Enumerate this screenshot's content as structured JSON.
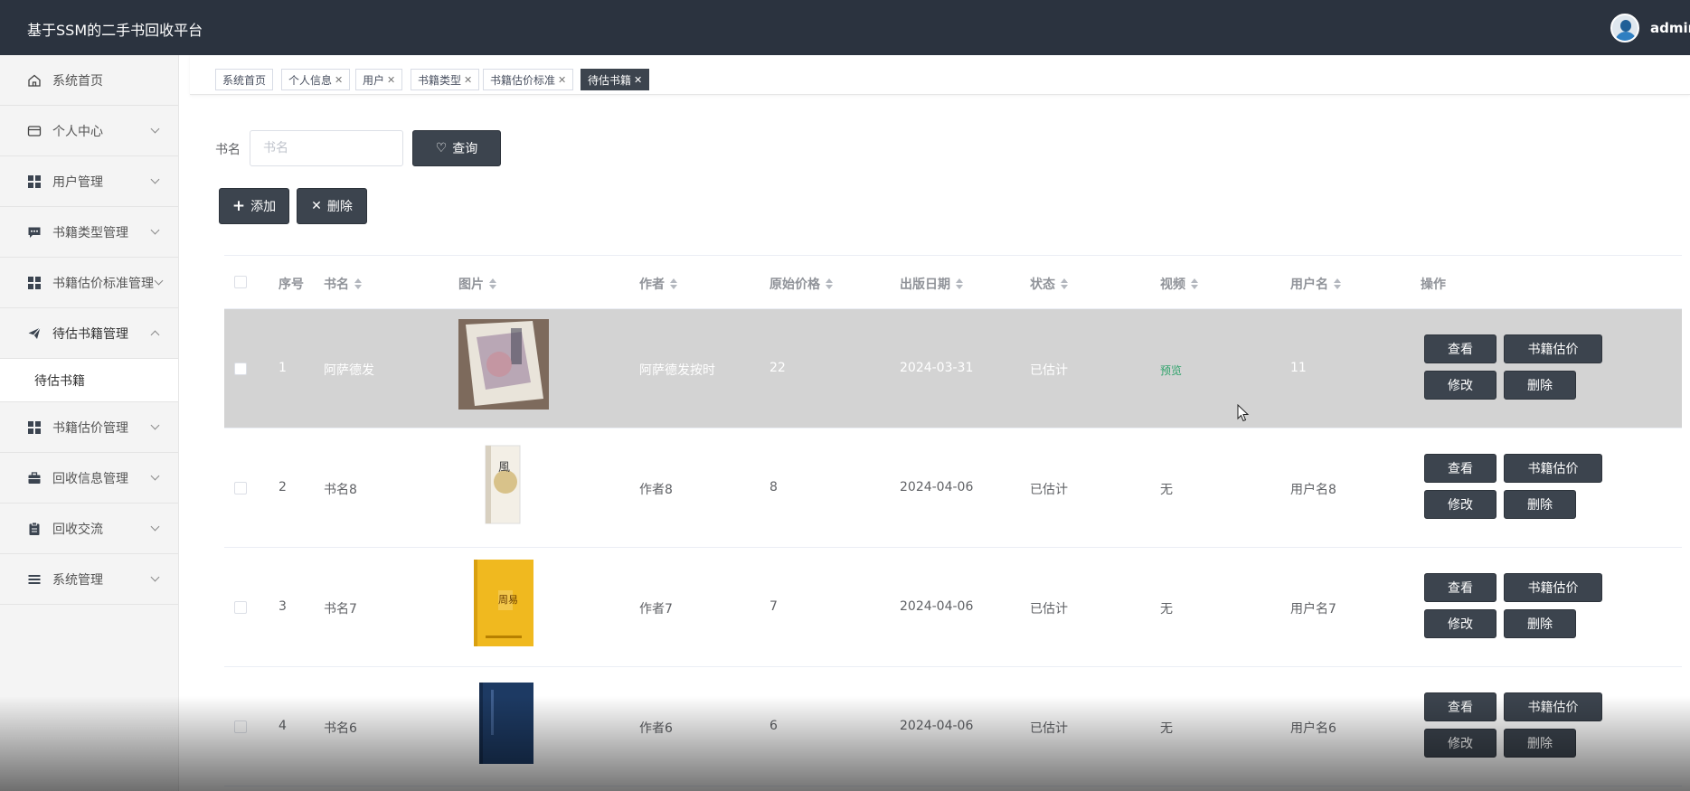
{
  "header": {
    "title": "基于SSM的二手书回收平台",
    "username": "admin"
  },
  "sidebar": {
    "items": [
      {
        "label": "系统首页",
        "icon": "home-icon"
      },
      {
        "label": "个人中心",
        "icon": "wallet-icon"
      },
      {
        "label": "用户管理",
        "icon": "grid-icon"
      },
      {
        "label": "书籍类型管理",
        "icon": "chat-icon"
      },
      {
        "label": "书籍估价标准管理",
        "icon": "grid-icon"
      },
      {
        "label": "待估书籍管理",
        "icon": "send-icon"
      },
      {
        "label": "书籍估价管理",
        "icon": "grid-icon"
      },
      {
        "label": "回收信息管理",
        "icon": "briefcase-icon"
      },
      {
        "label": "回收交流",
        "icon": "clipboard-icon"
      },
      {
        "label": "系统管理",
        "icon": "list-icon"
      }
    ],
    "submenu": {
      "label": "待估书籍"
    }
  },
  "tabs": [
    "系统首页",
    "个人信息",
    "用户",
    "书籍类型",
    "书籍估价标准",
    "待估书籍"
  ],
  "search": {
    "label": "书名",
    "placeholder": "书名",
    "button": "查询"
  },
  "actions": {
    "add": "添加",
    "delete": "删除"
  },
  "table": {
    "headers": [
      "序号",
      "书名",
      "图片",
      "作者",
      "原始价格",
      "出版日期",
      "状态",
      "视频",
      "用户名",
      "操作"
    ],
    "rows": [
      {
        "index": "1",
        "name": "阿萨德发",
        "author": "阿萨德发按时",
        "price": "22",
        "date": "2024-03-31",
        "status": "已估计",
        "video": "预览",
        "user": "11"
      },
      {
        "index": "2",
        "name": "书名8",
        "author": "作者8",
        "price": "8",
        "date": "2024-04-06",
        "status": "已估计",
        "video": "无",
        "user": "用户名8"
      },
      {
        "index": "3",
        "name": "书名7",
        "author": "作者7",
        "price": "7",
        "date": "2024-04-06",
        "status": "已估计",
        "video": "无",
        "user": "用户名7"
      },
      {
        "index": "4",
        "name": "书名6",
        "author": "作者6",
        "price": "6",
        "date": "2024-04-06",
        "status": "已估计",
        "video": "无",
        "user": "用户名6"
      }
    ],
    "row_buttons": {
      "view": "查看",
      "estimate": "书籍估价",
      "edit": "修改",
      "delete": "删除"
    }
  },
  "colors": {
    "header_bg": "#2b333f",
    "button_bg": "#3c444e",
    "hover_row": "#d3d3d3",
    "link_green": "#2fa36b"
  }
}
